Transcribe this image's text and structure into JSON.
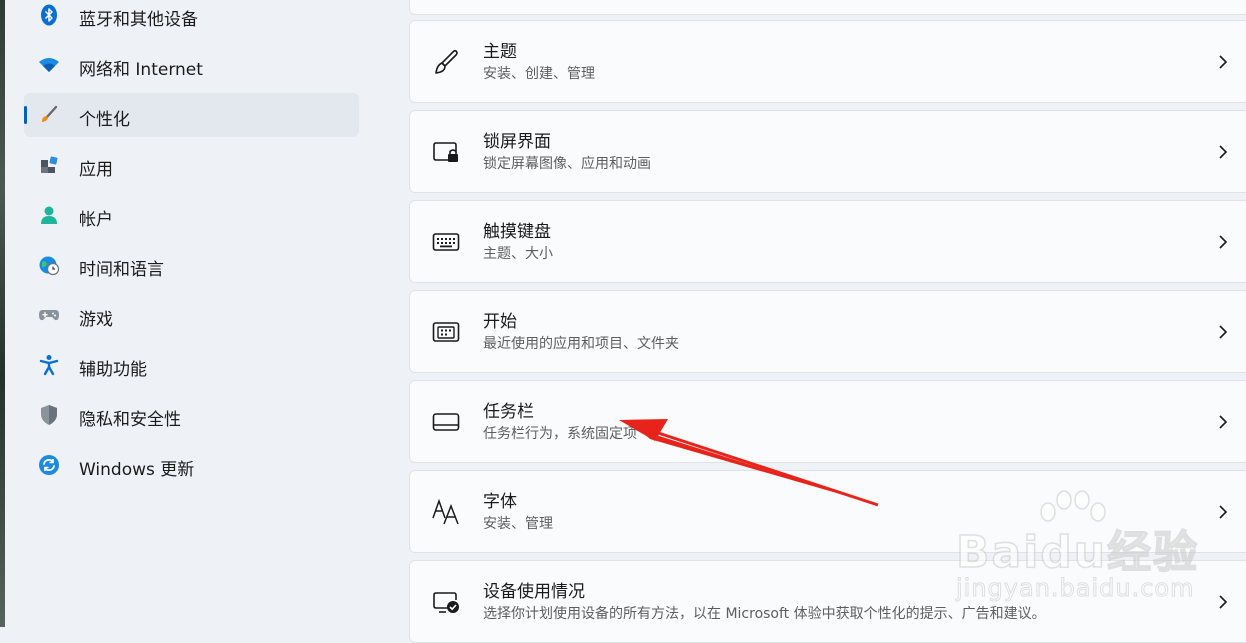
{
  "sidebar": {
    "items": [
      {
        "label": "蓝牙和其他设备",
        "icon": "bluetooth-icon",
        "active": false
      },
      {
        "label": "网络和 Internet",
        "icon": "wifi-icon",
        "active": false
      },
      {
        "label": "个性化",
        "icon": "brush-icon",
        "active": true
      },
      {
        "label": "应用",
        "icon": "apps-icon",
        "active": false
      },
      {
        "label": "帐户",
        "icon": "person-icon",
        "active": false
      },
      {
        "label": "时间和语言",
        "icon": "globe-clock-icon",
        "active": false
      },
      {
        "label": "游戏",
        "icon": "gamepad-icon",
        "active": false
      },
      {
        "label": "辅助功能",
        "icon": "accessibility-icon",
        "active": false
      },
      {
        "label": "隐私和安全性",
        "icon": "shield-icon",
        "active": false
      },
      {
        "label": "Windows 更新",
        "icon": "update-icon",
        "active": false
      }
    ]
  },
  "main": {
    "cards": [
      {
        "title": "主题",
        "subtitle": "安装、创建、管理",
        "icon": "brush-icon"
      },
      {
        "title": "锁屏界面",
        "subtitle": "锁定屏幕图像、应用和动画",
        "icon": "lock-screen-icon"
      },
      {
        "title": "触摸键盘",
        "subtitle": "主题、大小",
        "icon": "keyboard-icon"
      },
      {
        "title": "开始",
        "subtitle": "最近使用的应用和项目、文件夹",
        "icon": "start-icon"
      },
      {
        "title": "任务栏",
        "subtitle": "任务栏行为，系统固定项",
        "icon": "taskbar-icon"
      },
      {
        "title": "字体",
        "subtitle": "安装、管理",
        "icon": "font-icon"
      },
      {
        "title": "设备使用情况",
        "subtitle": "选择你计划使用设备的所有方法，以在 Microsoft 体验中获取个性化的提示、广告和建议。",
        "icon": "device-usage-icon"
      }
    ]
  },
  "watermark": {
    "main": "Baidu经验",
    "sub": "jingyan.baidu.com"
  },
  "colors": {
    "accent": "#005fb8",
    "arrow": "#e8231b",
    "background": "#eef2f6",
    "card": "#f9fbfc"
  }
}
